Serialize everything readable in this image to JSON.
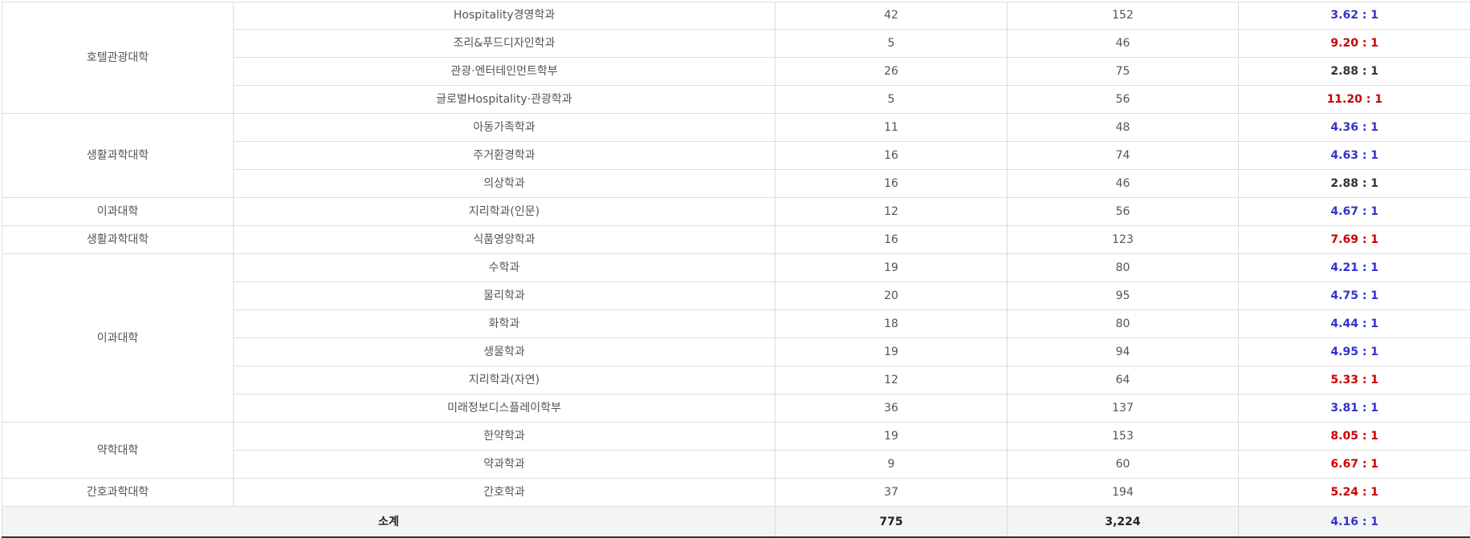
{
  "rows": [
    {
      "college": "호텔관광대학",
      "span": 4,
      "dept": "Hospitality경영학과",
      "recruit": "42",
      "applicants": "152",
      "rate": "3.62 : 1",
      "level": "mid"
    },
    {
      "dept": "조리&푸드디자인학과",
      "recruit": "5",
      "applicants": "46",
      "rate": "9.20 : 1",
      "level": "hi"
    },
    {
      "dept": "관광·엔터테인먼트학부",
      "recruit": "26",
      "applicants": "75",
      "rate": "2.88 : 1",
      "level": "lo"
    },
    {
      "dept": "글로벌Hospitality·관광학과",
      "recruit": "5",
      "applicants": "56",
      "rate": "11.20 : 1",
      "level": "hi"
    },
    {
      "college": "생활과학대학",
      "span": 3,
      "dept": "아동가족학과",
      "recruit": "11",
      "applicants": "48",
      "rate": "4.36 : 1",
      "level": "mid"
    },
    {
      "dept": "주거환경학과",
      "recruit": "16",
      "applicants": "74",
      "rate": "4.63 : 1",
      "level": "mid"
    },
    {
      "dept": "의상학과",
      "recruit": "16",
      "applicants": "46",
      "rate": "2.88 : 1",
      "level": "lo"
    },
    {
      "college": "이과대학",
      "span": 1,
      "dept": "지리학과(인문)",
      "recruit": "12",
      "applicants": "56",
      "rate": "4.67 : 1",
      "level": "mid"
    },
    {
      "college": "생활과학대학",
      "span": 1,
      "dept": "식품영양학과",
      "recruit": "16",
      "applicants": "123",
      "rate": "7.69 : 1",
      "level": "hi"
    },
    {
      "college": "이과대학",
      "span": 6,
      "dept": "수학과",
      "recruit": "19",
      "applicants": "80",
      "rate": "4.21 : 1",
      "level": "mid"
    },
    {
      "dept": "물리학과",
      "recruit": "20",
      "applicants": "95",
      "rate": "4.75 : 1",
      "level": "mid"
    },
    {
      "dept": "화학과",
      "recruit": "18",
      "applicants": "80",
      "rate": "4.44 : 1",
      "level": "mid"
    },
    {
      "dept": "생물학과",
      "recruit": "19",
      "applicants": "94",
      "rate": "4.95 : 1",
      "level": "mid"
    },
    {
      "dept": "지리학과(자연)",
      "recruit": "12",
      "applicants": "64",
      "rate": "5.33 : 1",
      "level": "hi"
    },
    {
      "dept": "미래정보디스플레이학부",
      "recruit": "36",
      "applicants": "137",
      "rate": "3.81 : 1",
      "level": "mid"
    },
    {
      "college": "약학대학",
      "span": 2,
      "dept": "한약학과",
      "recruit": "19",
      "applicants": "153",
      "rate": "8.05 : 1",
      "level": "hi"
    },
    {
      "dept": "약과학과",
      "recruit": "9",
      "applicants": "60",
      "rate": "6.67 : 1",
      "level": "hi"
    },
    {
      "college": "간호과학대학",
      "span": 1,
      "dept": "간호학과",
      "recruit": "37",
      "applicants": "194",
      "rate": "5.24 : 1",
      "level": "hi"
    }
  ],
  "total": {
    "label": "소계",
    "recruit": "775",
    "applicants": "3,224",
    "rate": "4.16 : 1"
  },
  "colors": {
    "high_rate": "#cc0000",
    "mid_rate": "#3333cc",
    "low_rate": "#333333",
    "border": "#dcdcdc",
    "total_bg": "#f4f4f4"
  }
}
